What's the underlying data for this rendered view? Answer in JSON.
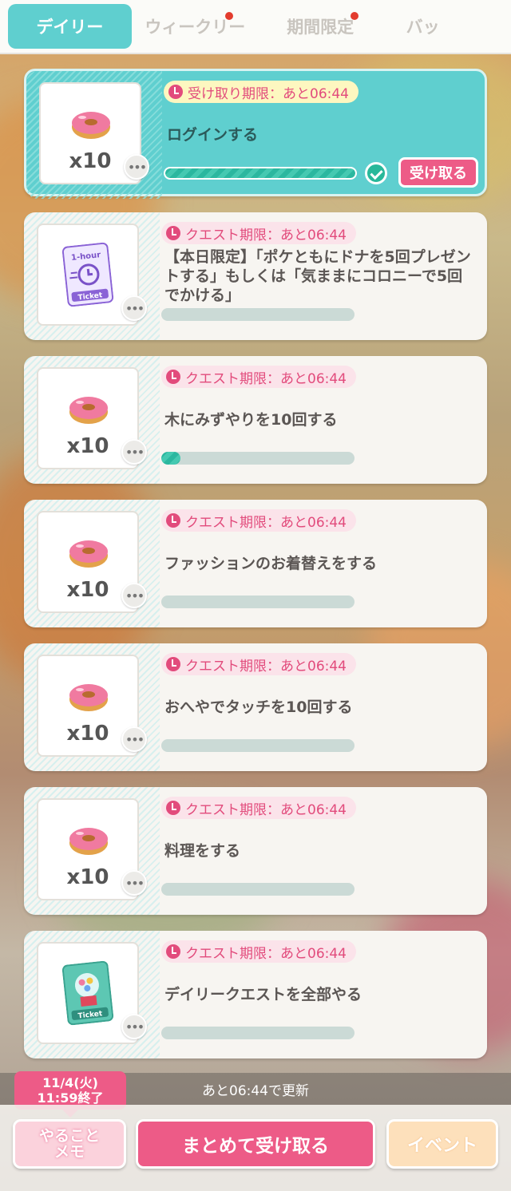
{
  "tabs": [
    {
      "label": "デイリー",
      "active": true,
      "badge": false
    },
    {
      "label": "ウィークリー",
      "active": false,
      "badge": true
    },
    {
      "label": "期間限定",
      "active": false,
      "badge": true
    },
    {
      "label": "バッ",
      "active": false,
      "badge": false
    }
  ],
  "quests": [
    {
      "deadline": "受け取り期限：あと06:44",
      "text": "ログインする",
      "reward": "donut",
      "qty": "x10",
      "progress": 1.0,
      "done": true,
      "claim_label": "受け取る"
    },
    {
      "deadline": "クエスト期限：あと06:44",
      "text": "【本日限定】「ポケともにドナを5回プレゼントする」もしくは「気ままにコロニーで5回でかける」",
      "reward": "1-hour-ticket",
      "ticket_top": "1-hour",
      "ticket_bottom": "Ticket",
      "qty": "",
      "progress": 0,
      "done": false
    },
    {
      "deadline": "クエスト期限：あと06:44",
      "text": "木にみずやりを10回する",
      "reward": "donut",
      "qty": "x10",
      "progress": 0.1,
      "done": false
    },
    {
      "deadline": "クエスト期限：あと06:44",
      "text": "ファッションのお着替えをする",
      "reward": "donut",
      "qty": "x10",
      "progress": 0,
      "done": false
    },
    {
      "deadline": "クエスト期限：あと06:44",
      "text": "おへやでタッチを10回する",
      "reward": "donut",
      "qty": "x10",
      "progress": 0,
      "done": false
    },
    {
      "deadline": "クエスト期限：あと06:44",
      "text": "料理をする",
      "reward": "donut",
      "qty": "x10",
      "progress": 0,
      "done": false
    },
    {
      "deadline": "クエスト期限：あと06:44",
      "text": "デイリークエストを全部やる",
      "reward": "gacha-ticket",
      "ticket_bottom": "Ticket",
      "qty": "",
      "progress": 0,
      "done": false
    }
  ],
  "footer": {
    "update_text": "あと06:44で更新",
    "date_line1": "11/4(火)",
    "date_line2": "11:59終了",
    "memo_line1": "やること",
    "memo_line2": "メモ",
    "bulk_claim": "まとめて受け取る",
    "event": "イベント"
  },
  "colors": {
    "accent": "#5fcfcf",
    "pink": "#ed5b87",
    "progress": "#2bb79f"
  }
}
